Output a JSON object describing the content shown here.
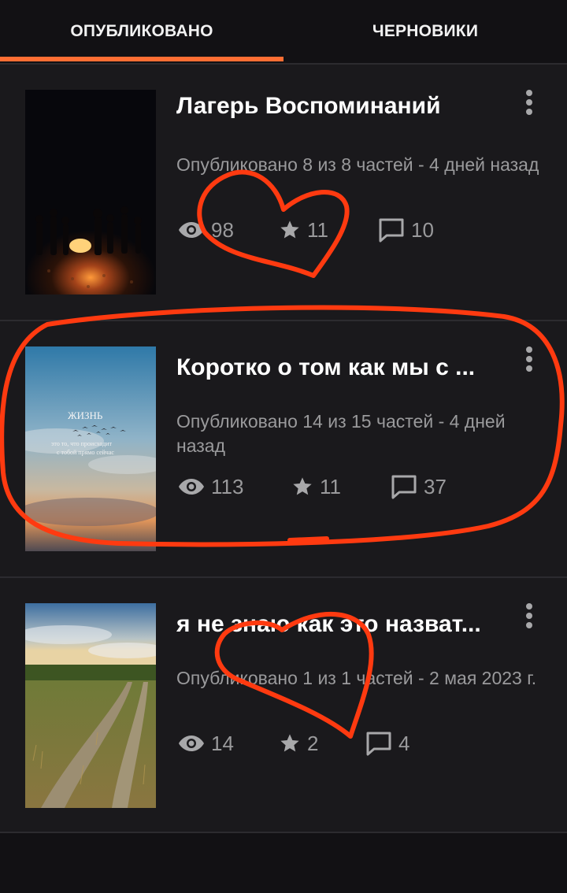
{
  "tabs": {
    "published_label": "ОПУБЛИКОВАНО",
    "drafts_label": "ЧЕРНОВИКИ",
    "accent_color": "#ff6e33"
  },
  "stories": [
    {
      "title": "Лагерь Воспоминаний",
      "meta": "Опубликовано 8 из 8 частей - 4 дней назад",
      "views": "98",
      "votes": "11",
      "comments": "10"
    },
    {
      "title": "Коротко о том как мы с ...",
      "meta": "Опубликовано 14 из 15 частей - 4 дней назад",
      "views": "113",
      "votes": "11",
      "comments": "37",
      "cover_text": {
        "title": "ЖИЗНЬ",
        "line1": "это то, что происходит",
        "line2": "с тобой прямо сейчас"
      }
    },
    {
      "title": "я не знаю как это назват...",
      "meta": "Опубликовано 1 из 1 частей - 2 мая 2023 г.",
      "views": "14",
      "votes": "2",
      "comments": "4"
    }
  ],
  "icons": {
    "views": "eye-icon",
    "votes": "star-icon",
    "comments": "comment-icon",
    "menu": "more-vertical-icon"
  },
  "annotation_color": "#ff3a10"
}
